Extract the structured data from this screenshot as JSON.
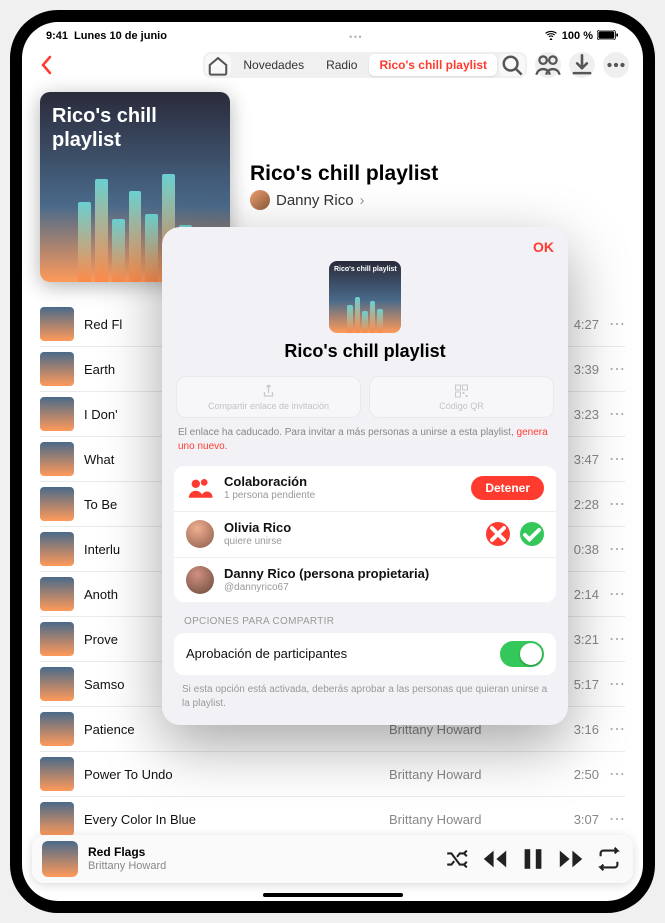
{
  "status": {
    "time": "9:41",
    "date": "Lunes 10 de junio",
    "battery": "100 %"
  },
  "nav": {
    "segments": [
      "Novedades",
      "Radio",
      "Rico's chill playlist"
    ]
  },
  "hero": {
    "art_title": "Rico's chill playlist",
    "title": "Rico's chill playlist",
    "author": "Danny Rico",
    "shuffle_label": "aleatorio"
  },
  "tracks": [
    {
      "title": "Red Fl",
      "artist": "",
      "dur": "4:27"
    },
    {
      "title": "Earth",
      "artist": "",
      "dur": "3:39"
    },
    {
      "title": "I Don'",
      "artist": "",
      "dur": "3:23"
    },
    {
      "title": "What",
      "artist": "",
      "dur": "3:47"
    },
    {
      "title": "To Be",
      "artist": "",
      "dur": "2:28"
    },
    {
      "title": "Interlu",
      "artist": "",
      "dur": "0:38"
    },
    {
      "title": "Anoth",
      "artist": "",
      "dur": "2:14"
    },
    {
      "title": "Prove",
      "artist": "",
      "dur": "3:21"
    },
    {
      "title": "Samso",
      "artist": "",
      "dur": "5:17"
    },
    {
      "title": "Patience",
      "artist": "Brittany Howard",
      "dur": "3:16"
    },
    {
      "title": "Power To Undo",
      "artist": "Brittany Howard",
      "dur": "2:50"
    },
    {
      "title": "Every Color In Blue",
      "artist": "Brittany Howard",
      "dur": "3:07"
    }
  ],
  "now_playing": {
    "title": "Red Flags",
    "artist": "Brittany Howard"
  },
  "modal": {
    "ok": "OK",
    "art_title": "Rico's chill playlist",
    "title": "Rico's chill playlist",
    "share_invite_label": "Compartir enlace de invitación",
    "qr_label": "Código QR",
    "link_msg_prefix": "El enlace ha caducado. Para invitar a más personas a unirse a esta playlist, ",
    "link_msg_action": "genera uno nuevo.",
    "collab": {
      "title": "Colaboración",
      "subtitle": "1 persona pendiente",
      "stop": "Detener"
    },
    "pending": {
      "name": "Olivia Rico",
      "sub": "quiere unirse"
    },
    "owner": {
      "name": "Danny Rico (persona propietaria)",
      "sub": "@dannyrico67"
    },
    "section_label": "Opciones para compartir",
    "approval_label": "Aprobación de participantes",
    "footnote": "Si esta opción está activada, deberás aprobar a las personas que quieran unirse a la playlist."
  }
}
